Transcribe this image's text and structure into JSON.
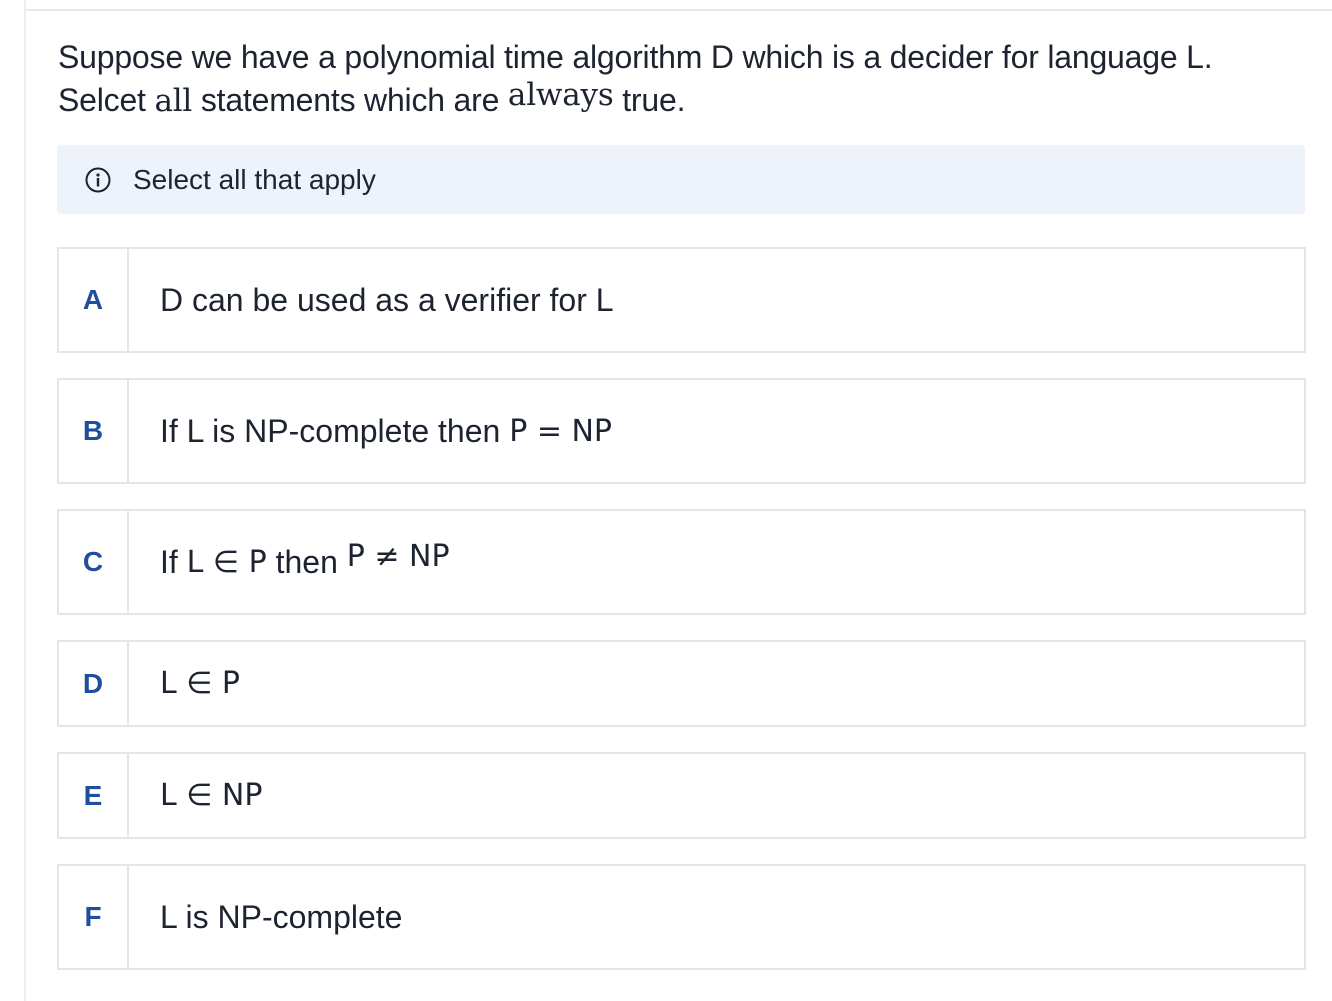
{
  "question": {
    "part1": "Suppose we have a polynomial time algorithm D which is a decider for language L.",
    "part2a": "Selcet ",
    "part2b": "all",
    "part2c": " statements which are ",
    "part2d": "always",
    "part2e": " true."
  },
  "hint": {
    "icon": "info-icon",
    "text": "Select all that apply"
  },
  "options": [
    {
      "letter": "A",
      "text": "D can be used as a verifier for L"
    },
    {
      "letter": "B",
      "pre": "If L is NP-complete then ",
      "math": "P = NP"
    },
    {
      "letter": "C",
      "pre": "If ",
      "math1": "L ∈ P",
      "mid": " then ",
      "math2": "P ≠ NP"
    },
    {
      "letter": "D",
      "math": "L ∈ P"
    },
    {
      "letter": "E",
      "math": "L ∈ NP"
    },
    {
      "letter": "F",
      "text": "L is NP-complete"
    }
  ],
  "colors": {
    "accent": "#1f4e9c",
    "hint_bg": "#eef2fb",
    "border": "#e3e5e9"
  }
}
